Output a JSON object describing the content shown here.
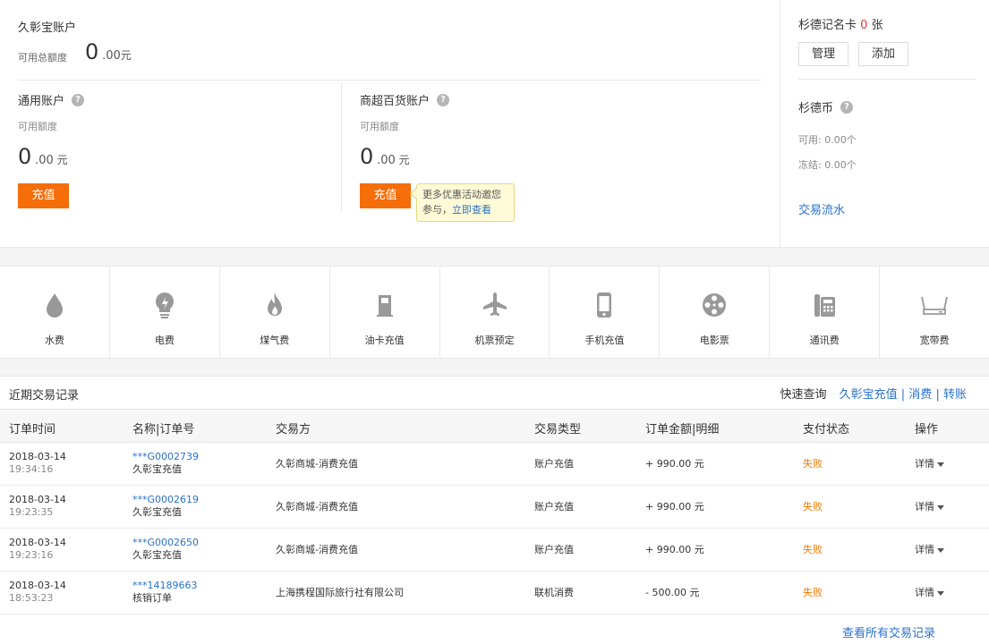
{
  "account": {
    "title": "久彰宝账户",
    "avail_total_label": "可用总额度",
    "avail_total_int": "0",
    "avail_total_dec": ".00",
    "unit": "元"
  },
  "general": {
    "title": "通用账户",
    "avail_label": "可用额度",
    "amount_int": "0",
    "amount_dec": ".00",
    "unit": "元",
    "recharge_label": "充值"
  },
  "mall": {
    "title": "商超百货账户",
    "avail_label": "可用额度",
    "amount_int": "0",
    "amount_dec": ".00",
    "unit": "元",
    "recharge_label": "充值"
  },
  "tip": {
    "text": "更多优惠活动邀您参与，",
    "link": "立即查看"
  },
  "card": {
    "title_prefix": "杉德记名卡",
    "count": "0",
    "title_suffix": "张",
    "manage_label": "管理",
    "add_label": "添加"
  },
  "coin": {
    "title": "杉德币",
    "available": "可用: 0.00个",
    "frozen": "冻结: 0.00个",
    "flow_link": "交易流水"
  },
  "services": [
    {
      "label": "水费",
      "icon": "water-drop-icon"
    },
    {
      "label": "电费",
      "icon": "lightbulb-icon"
    },
    {
      "label": "煤气费",
      "icon": "flame-icon"
    },
    {
      "label": "油卡充值",
      "icon": "fuel-pump-icon"
    },
    {
      "label": "机票预定",
      "icon": "airplane-icon"
    },
    {
      "label": "手机充值",
      "icon": "mobile-phone-icon"
    },
    {
      "label": "电影票",
      "icon": "film-reel-icon"
    },
    {
      "label": "通讯费",
      "icon": "telephone-icon"
    },
    {
      "label": "宽带费",
      "icon": "router-icon"
    }
  ],
  "transactions": {
    "title": "近期交易记录",
    "quick_label": "快速查询",
    "quick_links": [
      "久彰宝充值",
      "消费",
      "转账"
    ],
    "headers": [
      "订单时间",
      "名称|订单号",
      "交易方",
      "交易类型",
      "订单金额|明细",
      "支付状态",
      "操作"
    ],
    "rows": [
      {
        "date": "2018-03-14",
        "time": "19:34:16",
        "order": "***G0002739",
        "name": "久彰宝充值",
        "party": "久彰商城-消费充值",
        "type": "账户充值",
        "amount": "+ 990.00 元",
        "status": "失败",
        "action": "详情"
      },
      {
        "date": "2018-03-14",
        "time": "19:23:35",
        "order": "***G0002619",
        "name": "久彰宝充值",
        "party": "久彰商城-消费充值",
        "type": "账户充值",
        "amount": "+ 990.00 元",
        "status": "失败",
        "action": "详情"
      },
      {
        "date": "2018-03-14",
        "time": "19:23:16",
        "order": "***G0002650",
        "name": "久彰宝充值",
        "party": "久彰商城-消费充值",
        "type": "账户充值",
        "amount": "+ 990.00 元",
        "status": "失败",
        "action": "详情"
      },
      {
        "date": "2018-03-14",
        "time": "18:53:23",
        "order": "***14189663",
        "name": "核销订单",
        "party": "上海携程国际旅行社有限公司",
        "type": "联机消费",
        "amount": "- 500.00 元",
        "status": "失败",
        "action": "详情"
      }
    ],
    "all_link": "查看所有交易记录"
  },
  "colors": {
    "accent_orange": "#f56e0a",
    "link_blue": "#2a72c8",
    "status_fail": "#f07b00",
    "count_red": "#e4393c"
  }
}
